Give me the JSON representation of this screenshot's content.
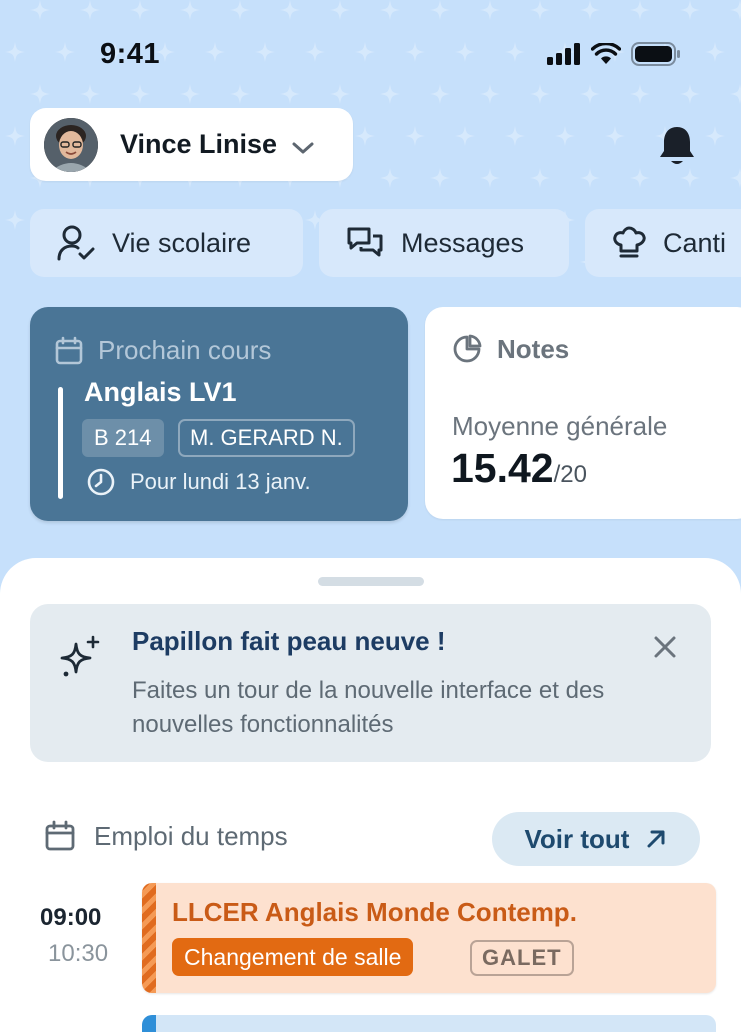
{
  "status_bar": {
    "time": "9:41"
  },
  "profile": {
    "name": "Vince Linise"
  },
  "quick_actions": [
    {
      "label": "Vie scolaire",
      "icon": "user-check-icon"
    },
    {
      "label": "Messages",
      "icon": "chat-bubbles-icon"
    },
    {
      "label": "Canti",
      "icon": "chef-hat-icon"
    }
  ],
  "next_course": {
    "header": "Prochain cours",
    "subject": "Anglais LV1",
    "room": "B 214",
    "teacher": "M. GERARD N.",
    "when": "Pour lundi 13 janv."
  },
  "notes": {
    "header": "Notes",
    "average_label": "Moyenne générale",
    "average_value": "15.42",
    "average_max": "/20"
  },
  "banner": {
    "title": "Papillon fait peau neuve !",
    "description": "Faites un tour de la nouvelle interface et des nouvelles fonctionnalités"
  },
  "timetable": {
    "title": "Emploi du temps",
    "see_all": "Voir tout",
    "lessons": [
      {
        "start": "09:00",
        "end": "10:30",
        "subject": "LLCER Anglais Monde Contemp.",
        "status": "Changement de salle",
        "room": "GALET"
      }
    ]
  },
  "colors": {
    "background": "#c6e0fb",
    "course_card": "#4a7596",
    "lesson_orange": "#e26a12",
    "lesson_bg": "#fde1cf"
  }
}
